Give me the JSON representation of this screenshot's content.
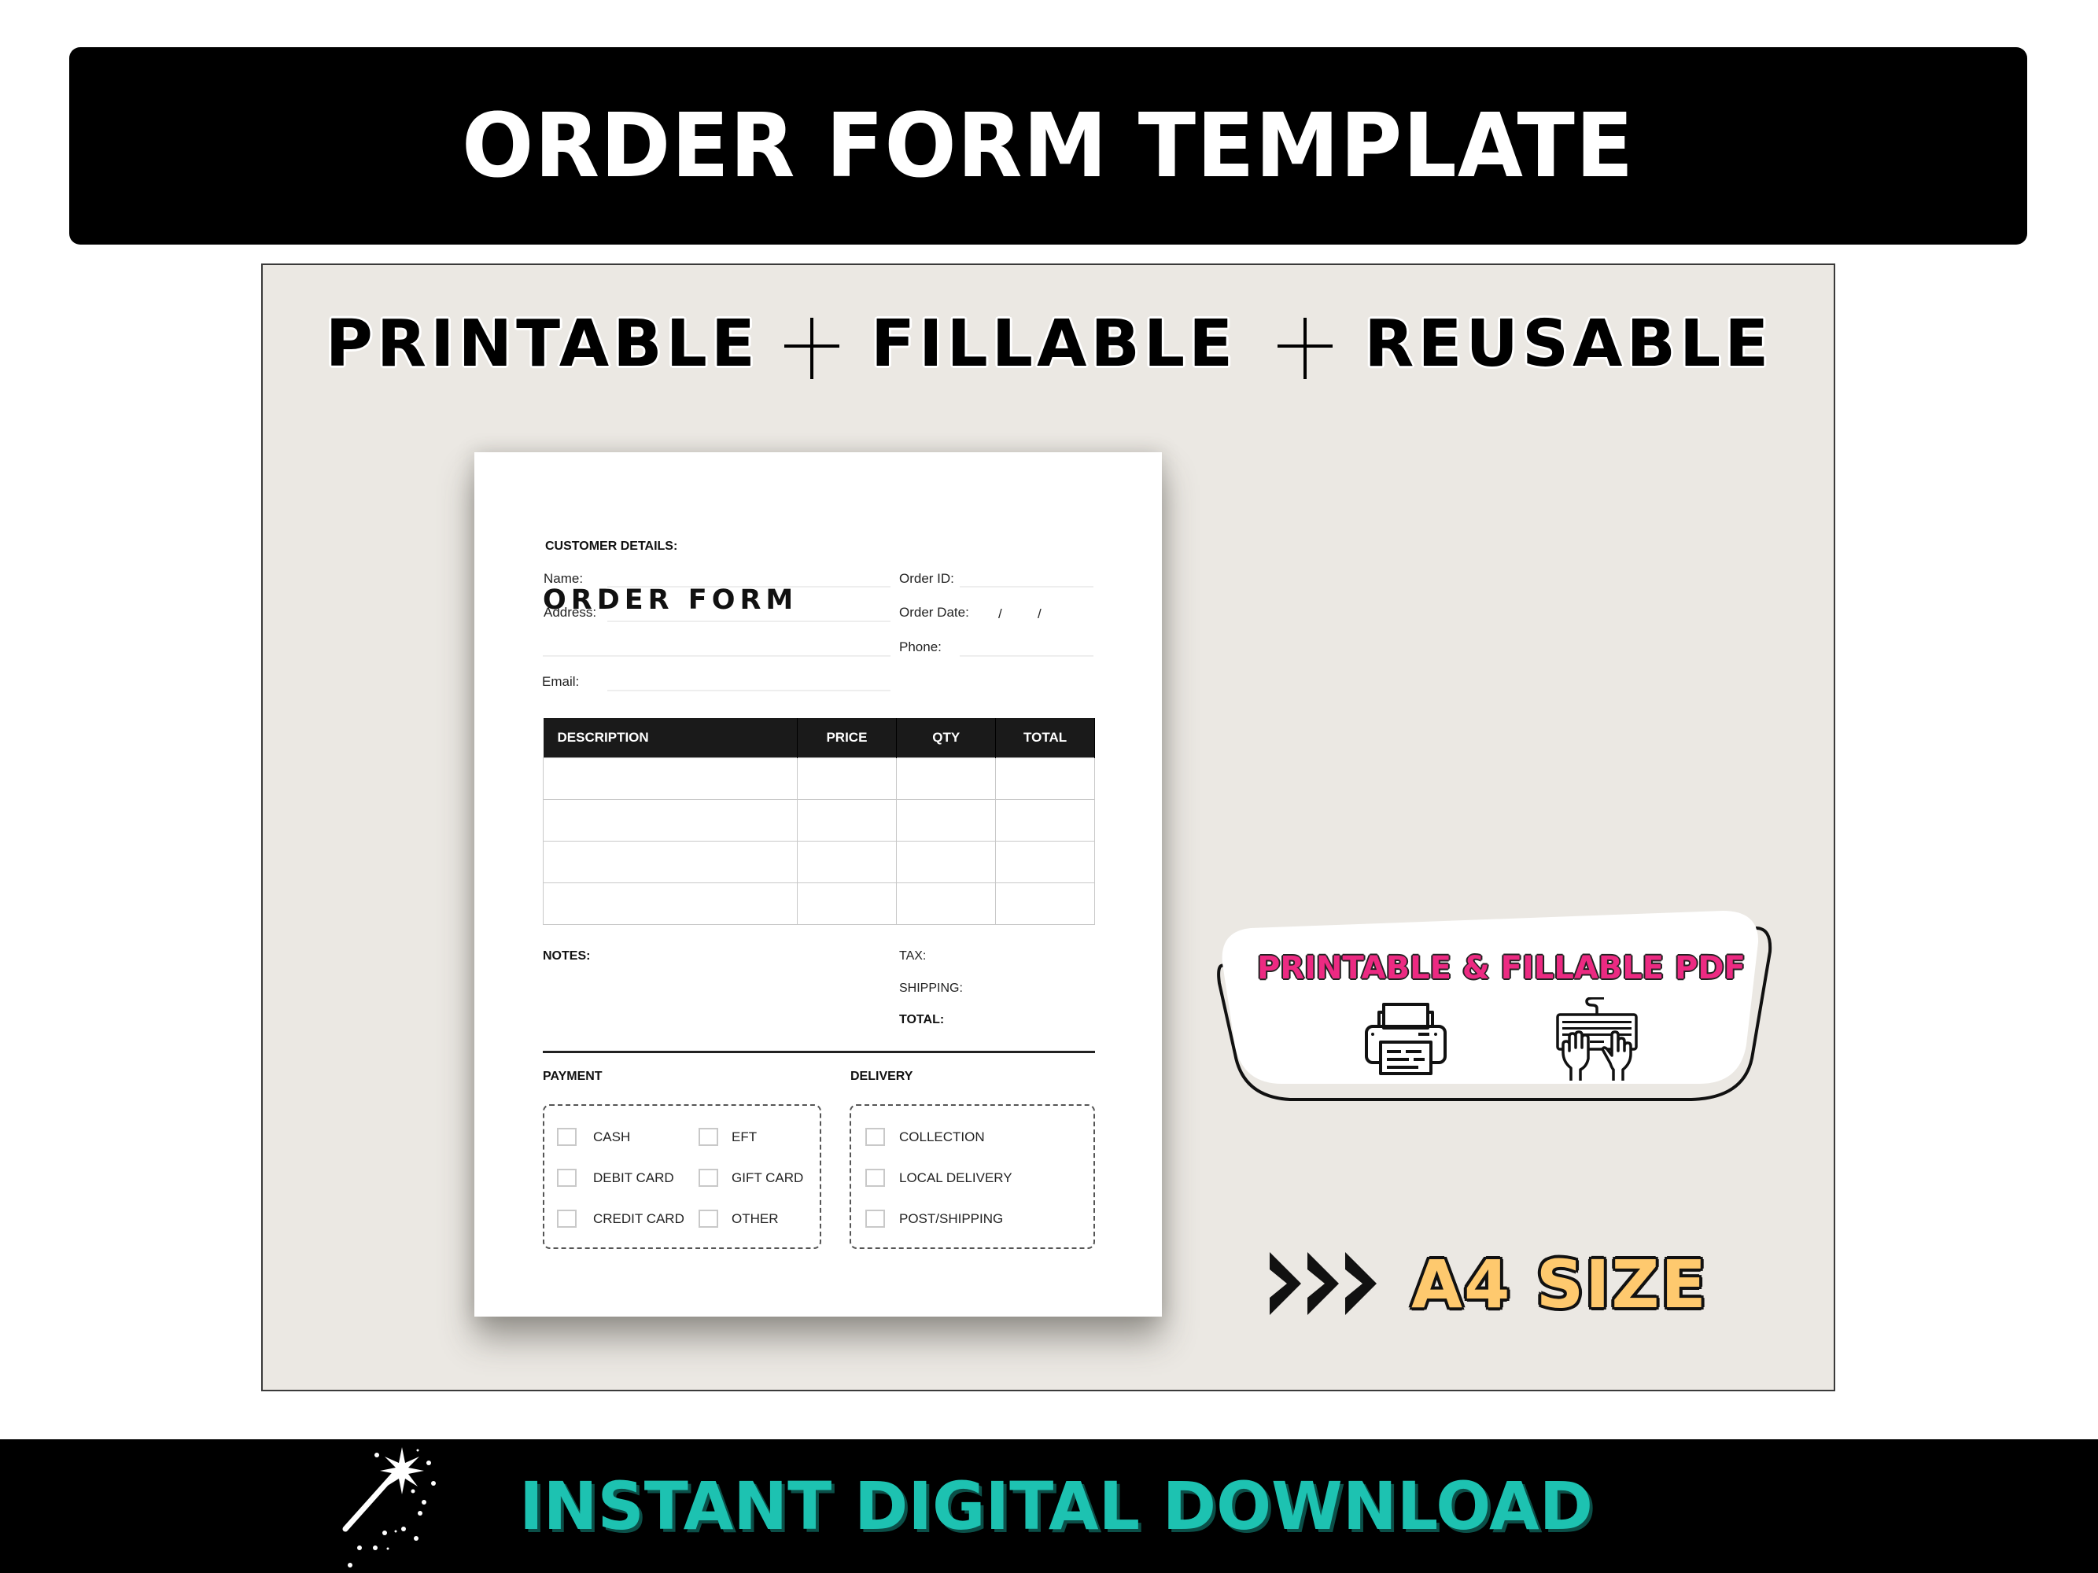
{
  "banner": {
    "title": "ORDER FORM TEMPLATE"
  },
  "tagline": {
    "words": [
      "PRINTABLE",
      "FILLABLE",
      "REUSABLE"
    ],
    "separator_icon": "plus-icon"
  },
  "form": {
    "title": "ORDER FORM",
    "customer_details_heading": "CUSTOMER DETAILS:",
    "fields": {
      "name": {
        "label": "Name:",
        "value": ""
      },
      "address": {
        "label": "Address:",
        "value": ""
      },
      "email": {
        "label": "Email:",
        "value": ""
      },
      "order_id": {
        "label": "Order ID:",
        "value": ""
      },
      "order_date": {
        "label": "Order Date:",
        "separator": "/",
        "value": ""
      },
      "phone": {
        "label": "Phone:",
        "value": ""
      }
    },
    "table": {
      "columns": [
        "DESCRIPTION",
        "PRICE",
        "QTY",
        "TOTAL"
      ],
      "rows": [
        [
          "",
          "",
          "",
          ""
        ],
        [
          "",
          "",
          "",
          ""
        ],
        [
          "",
          "",
          "",
          ""
        ],
        [
          "",
          "",
          "",
          ""
        ]
      ]
    },
    "notes_label": "NOTES:",
    "summary": {
      "tax": "TAX:",
      "shipping": "SHIPPING:",
      "total": "TOTAL:"
    },
    "payment": {
      "heading": "PAYMENT",
      "options": [
        {
          "label": "CASH",
          "checked": false
        },
        {
          "label": "EFT",
          "checked": false
        },
        {
          "label": "DEBIT CARD",
          "checked": false
        },
        {
          "label": "GIFT CARD",
          "checked": false
        },
        {
          "label": "CREDIT CARD",
          "checked": false
        },
        {
          "label": "OTHER",
          "checked": false
        }
      ]
    },
    "delivery": {
      "heading": "DELIVERY",
      "options": [
        {
          "label": "COLLECTION",
          "checked": false
        },
        {
          "label": "LOCAL DELIVERY",
          "checked": false
        },
        {
          "label": "POST/SHIPPING",
          "checked": false
        }
      ]
    }
  },
  "badge": {
    "title": "PRINTABLE  & FILLABLE PDF",
    "icons": [
      "printer-icon",
      "keyboard-typing-icon"
    ],
    "title_color": "#ec2a82"
  },
  "size_callout": {
    "text": "A4 SIZE",
    "icon": "triple-chevron-right-icon",
    "text_color": "#fec96e"
  },
  "footer": {
    "text": "INSTANT DIGITAL DOWNLOAD",
    "icon": "magic-wand-icon",
    "text_color": "#1dc2b1"
  }
}
